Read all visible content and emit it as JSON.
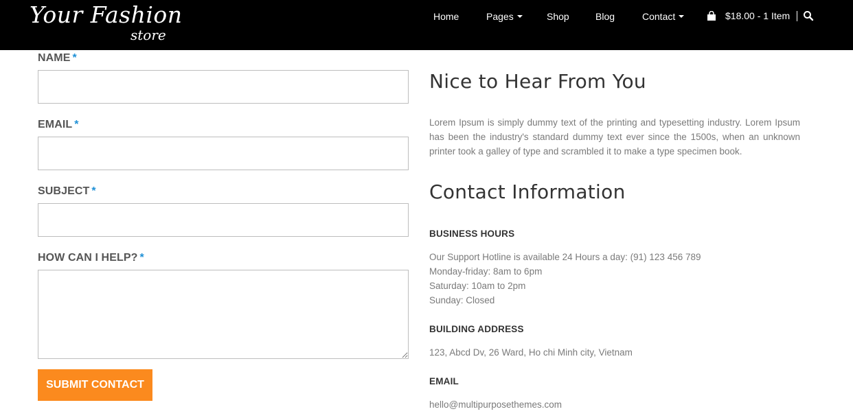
{
  "header": {
    "logo_line1": "Your Fashion",
    "logo_line2": "store",
    "nav": {
      "home": "Home",
      "pages": "Pages",
      "shop": "Shop",
      "blog": "Blog",
      "contact": "Contact"
    },
    "cart_text": "$18.00 - 1 Item"
  },
  "form": {
    "name_label": "NAME",
    "email_label": "EMAIL",
    "subject_label": "SUBJECT",
    "help_label": "HOW CAN I HELP?",
    "required_mark": "*",
    "name_value": "",
    "email_value": "",
    "subject_value": "",
    "help_value": "",
    "submit_label": "SUBMIT CONTACT"
  },
  "right": {
    "heading1": "Nice to Hear From You",
    "intro": "Lorem Ipsum is simply dummy text of the printing and typesetting industry. Lorem Ipsum has been the industry's standard dummy text ever since the 1500s, when an unknown printer took a galley of type and scrambled it to make a type specimen book.",
    "heading2": "Contact Information",
    "hours_title": "BUSINESS HOURS",
    "hours_lines": [
      "Our Support Hotline is available 24 Hours a day: (91) 123 456 789",
      "Monday-friday: 8am to 6pm",
      "Saturday: 10am to 2pm",
      "Sunday: Closed"
    ],
    "address_title": "BUILDING ADDRESS",
    "address": "123, Abcd Dv, 26 Ward, Ho chi Minh city, Vietnam",
    "email_title": "EMAIL",
    "email": "hello@multipurposethemes.com"
  },
  "colors": {
    "header_bg": "#000000",
    "accent_orange": "#fb8a1e",
    "required_blue": "#1e90d6"
  },
  "icons": [
    "shopping-bag-icon",
    "search-icon",
    "caret-down-icon"
  ]
}
